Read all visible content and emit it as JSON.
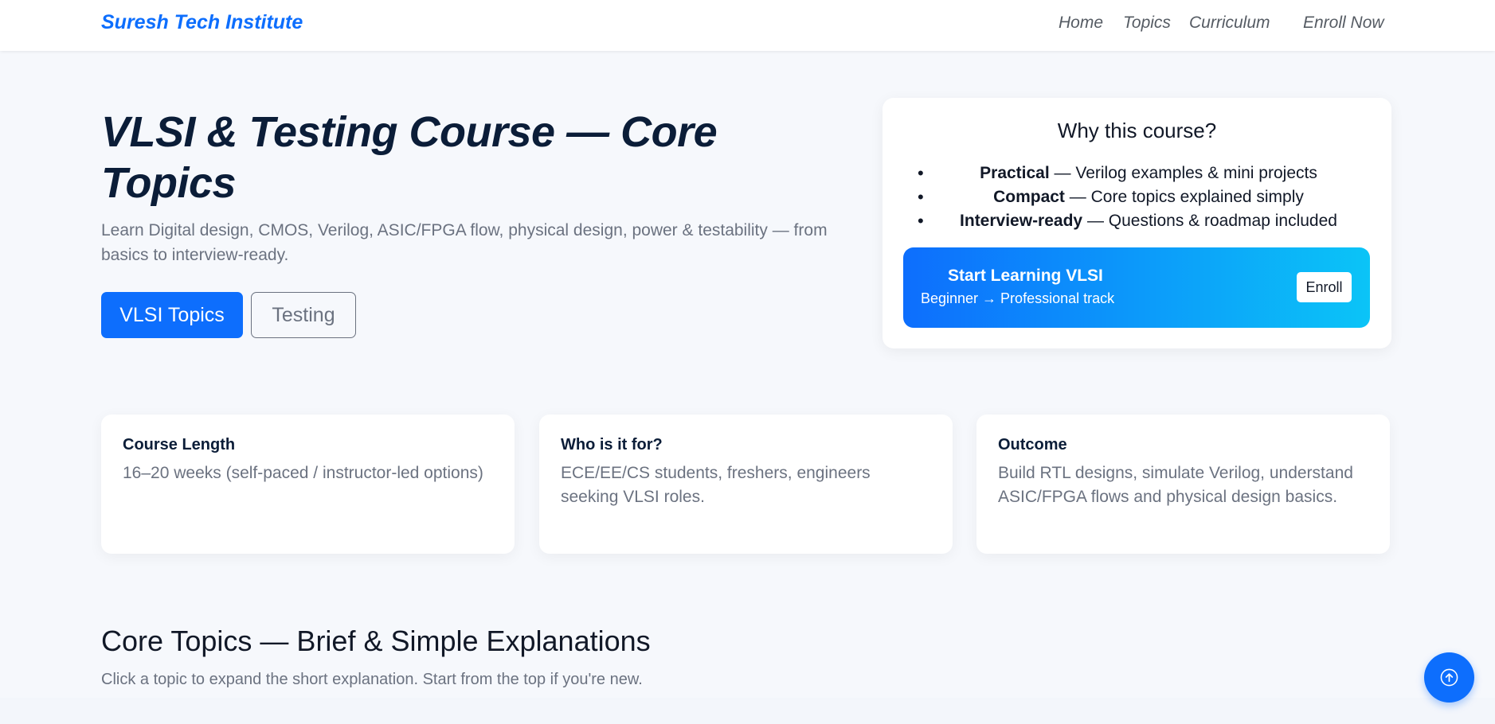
{
  "navbar": {
    "brand": "Suresh Tech Institute",
    "links": [
      "Home",
      "Topics",
      "Curriculum",
      "Enroll Now"
    ]
  },
  "hero": {
    "title": "VLSI & Testing Course — Core Topics",
    "subtitle": "Learn Digital design, CMOS, Verilog, ASIC/FPGA flow, physical design, power & testability — from basics to interview-ready.",
    "primary_button": "VLSI Topics",
    "secondary_button": "Testing"
  },
  "why_card": {
    "title": "Why this course?",
    "items": [
      {
        "bold": "Practical",
        "text": " — Verilog examples & mini projects"
      },
      {
        "bold": "Compact",
        "text": " — Core topics explained simply"
      },
      {
        "bold": "Interview-ready",
        "text": " — Questions & roadmap included"
      }
    ],
    "cta": {
      "title": "Start Learning VLSI",
      "subtitle": "Beginner → Professional track",
      "button": "Enroll"
    }
  },
  "info_cards": [
    {
      "title": "Course Length",
      "text": "16–20 weeks (self-paced / instructor-led options)"
    },
    {
      "title": "Who is it for?",
      "text": "ECE/EE/CS students, freshers, engineers seeking VLSI roles."
    },
    {
      "title": "Outcome",
      "text": "Build RTL designs, simulate Verilog, understand ASIC/FPGA flows and physical design basics."
    }
  ],
  "core_topics": {
    "title": "Core Topics — Brief & Simple Explanations",
    "subtitle": "Click a topic to expand the short explanation. Start from the top if you're new."
  },
  "icons": {
    "back_to_top": "arrow-up-circle-icon",
    "bullet": "bullet-dot"
  },
  "colors": {
    "primary": "#0d6efd",
    "gradient_end": "#0bc4f7",
    "heading": "#0b1d38",
    "muted": "#6b7280",
    "background": "#f6f8fc"
  }
}
